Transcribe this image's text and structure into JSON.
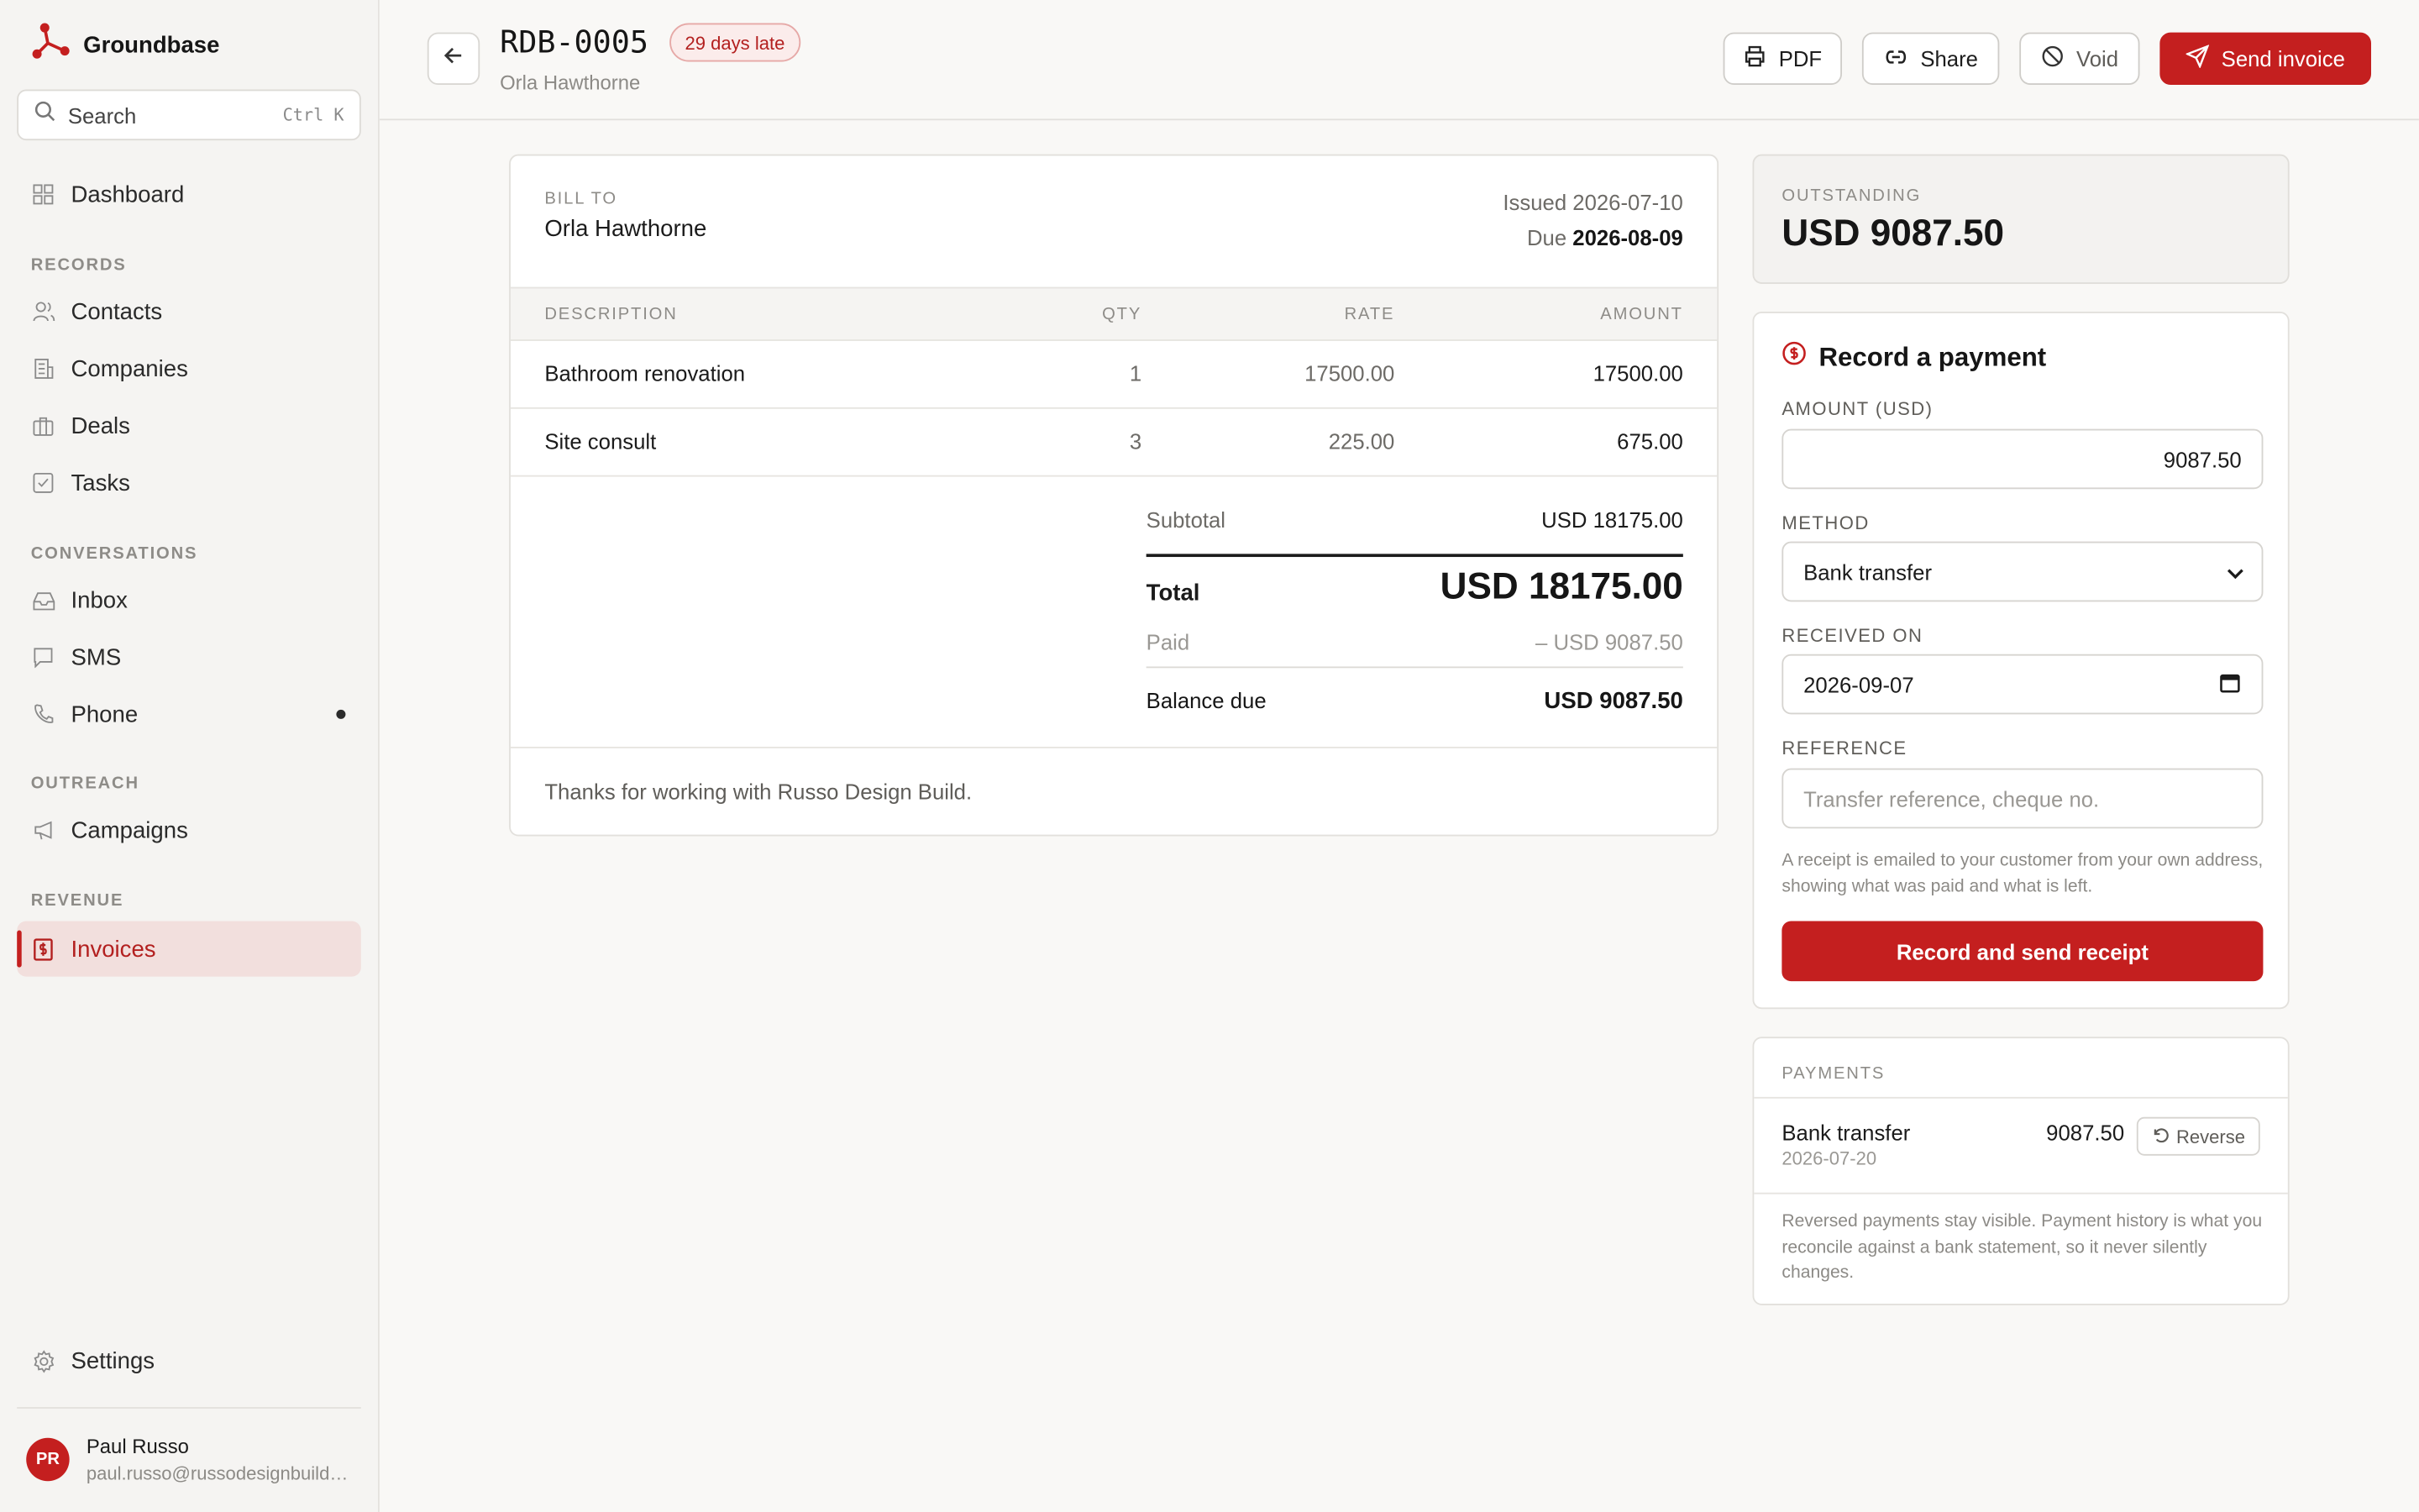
{
  "app": {
    "name": "Groundbase"
  },
  "search": {
    "label": "Search",
    "shortcut": "Ctrl K"
  },
  "sidebar": {
    "dashboard": "Dashboard",
    "sections": {
      "records": "RECORDS",
      "conversations": "CONVERSATIONS",
      "outreach": "OUTREACH",
      "revenue": "REVENUE"
    },
    "items": {
      "contacts": "Contacts",
      "companies": "Companies",
      "deals": "Deals",
      "tasks": "Tasks",
      "inbox": "Inbox",
      "sms": "SMS",
      "phone": "Phone",
      "campaigns": "Campaigns",
      "invoices": "Invoices",
      "settings": "Settings"
    }
  },
  "user": {
    "initials": "PR",
    "name": "Paul Russo",
    "email": "paul.russo@russodesignbuild.com"
  },
  "header": {
    "invoice_id": "RDB-0005",
    "late_badge": "29 days late",
    "customer": "Orla Hawthorne",
    "buttons": {
      "pdf": "PDF",
      "share": "Share",
      "void": "Void",
      "send": "Send invoice"
    }
  },
  "invoice": {
    "bill_to_label": "BILL TO",
    "bill_to_name": "Orla Hawthorne",
    "issued": "Issued 2026-07-10",
    "due_label": "Due",
    "due_date": "2026-08-09",
    "columns": {
      "description": "DESCRIPTION",
      "qty": "QTY",
      "rate": "RATE",
      "amount": "AMOUNT"
    },
    "lines": [
      {
        "description": "Bathroom renovation",
        "qty": "1",
        "rate": "17500.00",
        "amount": "17500.00"
      },
      {
        "description": "Site consult",
        "qty": "3",
        "rate": "225.00",
        "amount": "675.00"
      }
    ],
    "subtotal_label": "Subtotal",
    "subtotal": "USD 18175.00",
    "total_label": "Total",
    "total": "USD 18175.00",
    "paid_label": "Paid",
    "paid": "– USD 9087.50",
    "balance_label": "Balance due",
    "balance": "USD 9087.50",
    "footer": "Thanks for working with Russo Design Build."
  },
  "outstanding": {
    "label": "OUTSTANDING",
    "value": "USD 9087.50"
  },
  "payment_form": {
    "title": "Record a payment",
    "amount_label": "AMOUNT (USD)",
    "amount_value": "9087.50",
    "method_label": "METHOD",
    "method_value": "Bank transfer",
    "received_label": "RECEIVED ON",
    "received_value": "2026-09-07",
    "reference_label": "REFERENCE",
    "reference_placeholder": "Transfer reference, cheque no.",
    "help": "A receipt is emailed to your customer from your own address, showing what was paid and what is left.",
    "submit": "Record and send receipt"
  },
  "payments": {
    "label": "PAYMENTS",
    "items": [
      {
        "method": "Bank transfer",
        "date": "2026-07-20",
        "amount": "9087.50",
        "action": "Reverse"
      }
    ],
    "note": "Reversed payments stay visible. Payment history is what you reconcile against a bank statement, so it never silently changes."
  },
  "colors": {
    "accent": "#c41f1f",
    "background": "#f9f8f6",
    "sidebar": "#f5f4f2"
  }
}
